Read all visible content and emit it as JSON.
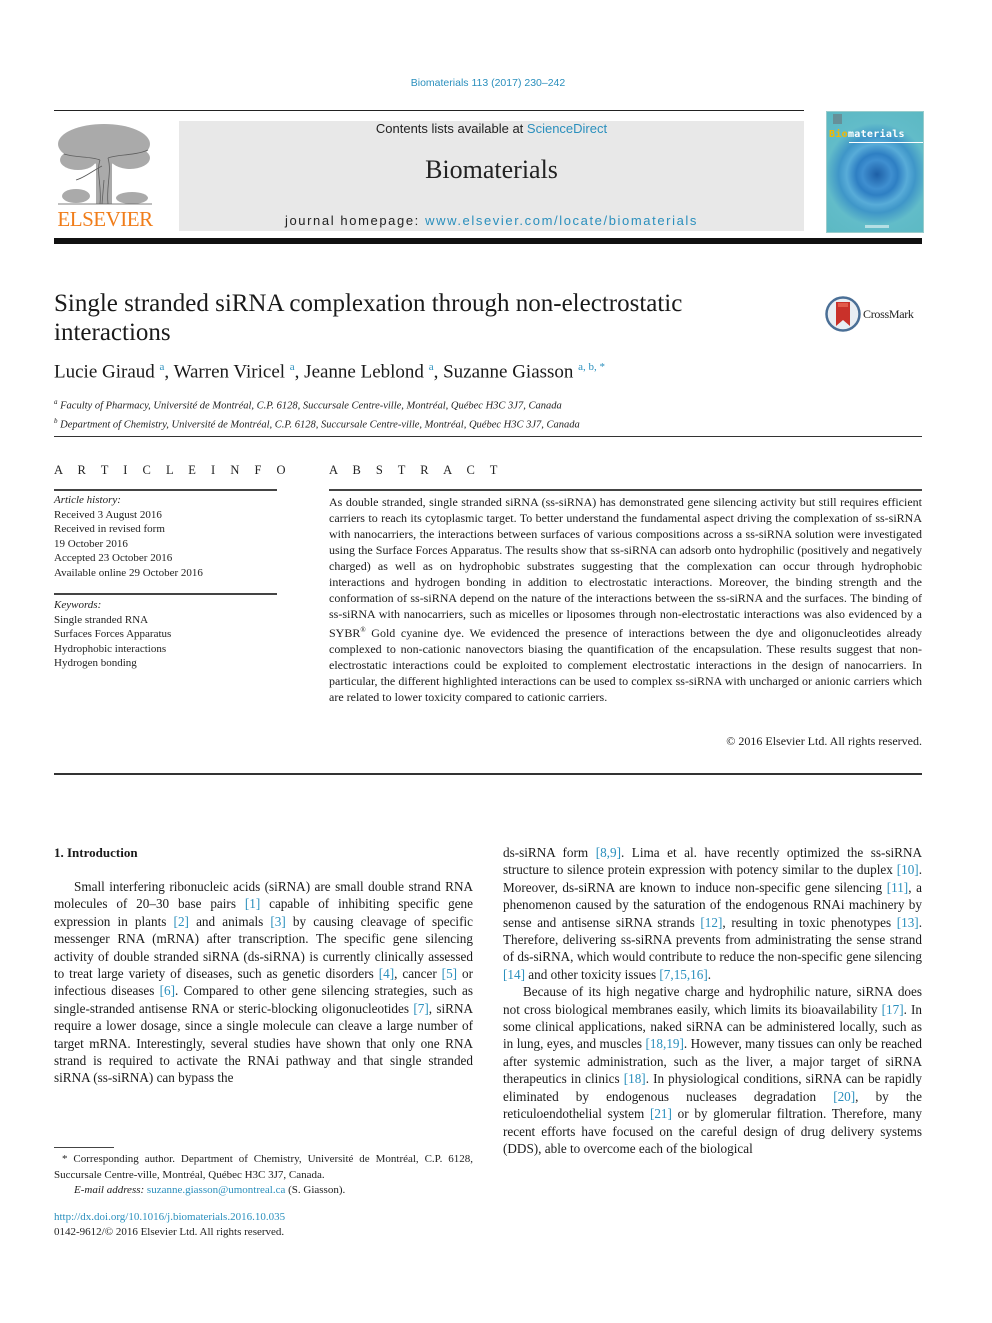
{
  "header": {
    "journal_ref": "Biomaterials 113 (2017) 230–242",
    "contents_prefix": "Contents lists available at ",
    "contents_link": "ScienceDirect",
    "journal_name": "Biomaterials",
    "homepage_prefix": "journal homepage: ",
    "homepage_link": "www.elsevier.com/locate/biomaterials",
    "publisher_wordmark": "ELSEVIER",
    "cover_title_accent": "Bio",
    "cover_title_rest": "materials",
    "publisher_color": "#f07d1a",
    "link_color": "#2a8fbd"
  },
  "article": {
    "title": "Single stranded siRNA complexation through non-electrostatic interactions",
    "crossmark_label": "CrossMark",
    "authors": [
      {
        "name": "Lucie Giraud",
        "sup": "a"
      },
      {
        "name": "Warren Viricel",
        "sup": "a"
      },
      {
        "name": "Jeanne Leblond",
        "sup": "a"
      },
      {
        "name": "Suzanne Giasson",
        "sup": "a, b, *"
      }
    ],
    "affiliations": [
      {
        "mark": "a",
        "text": "Faculty of Pharmacy, Université de Montréal, C.P. 6128, Succursale Centre-ville, Montréal, Québec H3C 3J7, Canada"
      },
      {
        "mark": "b",
        "text": "Department of Chemistry, Université de Montréal, C.P. 6128, Succursale Centre-ville, Montréal, Québec H3C 3J7, Canada"
      }
    ]
  },
  "article_info": {
    "heading": "A R T I C L E   I N F O",
    "history_label": "Article history:",
    "history": [
      "Received 3 August 2016",
      "Received in revised form",
      "19 October 2016",
      "Accepted 23 October 2016",
      "Available online 29 October 2016"
    ],
    "keywords_label": "Keywords:",
    "keywords": [
      "Single stranded RNA",
      "Surfaces Forces Apparatus",
      "Hydrophobic interactions",
      "Hydrogen bonding"
    ]
  },
  "abstract": {
    "heading": "A B S T R A C T",
    "text_part1": "As double stranded, single stranded siRNA (ss-siRNA) has demonstrated gene silencing activity but still requires efficient carriers to reach its cytoplasmic target. To better understand the fundamental aspect driving the complexation of ss-siRNA with nanocarriers, the interactions between surfaces of various compositions across a ss-siRNA solution were investigated using the Surface Forces Apparatus. The results show that ss-siRNA can adsorb onto hydrophilic (positively and negatively charged) as well as on hydrophobic substrates suggesting that the complexation can occur through hydrophobic interactions and hydrogen bonding in addition to electrostatic interactions. Moreover, the binding strength and the conformation of ss-siRNA depend on the nature of the interactions between the ss-siRNA and the surfaces. The binding of ss-siRNA with nanocarriers, such as micelles or liposomes through non-electrostatic interactions was also evidenced by a SYBR",
    "registered_mark": "®",
    "text_part2": " Gold cyanine dye. We evidenced the presence of interactions between the dye and oligonucleotides already complexed to non-cationic nanovectors biasing the quantification of the encapsulation. These results suggest that non-electrostatic interactions could be exploited to complement electrostatic interactions in the design of nanocarriers. In particular, the different highlighted interactions can be used to complex ss-siRNA with uncharged or anionic carriers which are related to lower toxicity compared to cationic carriers.",
    "copyright": "© 2016 Elsevier Ltd. All rights reserved."
  },
  "body": {
    "intro_heading": "1.  Introduction",
    "left_segments": [
      {
        "t": "Small interfering ribonucleic acids (siRNA) are small double strand RNA molecules of 20–30 base pairs "
      },
      {
        "ref": "[1]"
      },
      {
        "t": " capable of inhibiting specific gene expression in plants "
      },
      {
        "ref": "[2]"
      },
      {
        "t": " and animals "
      },
      {
        "ref": "[3]"
      },
      {
        "t": " by causing cleavage of specific messenger RNA (mRNA) after transcription. The specific gene silencing activity of double stranded siRNA (ds-siRNA) is currently clinically assessed to treat large variety of diseases, such as genetic disorders "
      },
      {
        "ref": "[4]"
      },
      {
        "t": ", cancer "
      },
      {
        "ref": "[5]"
      },
      {
        "t": " or infectious diseases "
      },
      {
        "ref": "[6]"
      },
      {
        "t": ". Compared to other gene silencing strategies, such as single-stranded antisense RNA or steric-blocking oligonucleotides "
      },
      {
        "ref": "[7]"
      },
      {
        "t": ", siRNA require a lower dosage, since a single molecule can cleave a large number of target mRNA. Interestingly, several studies have shown that only one RNA strand is required to activate the RNAi pathway and that single stranded siRNA (ss-siRNA) can bypass the"
      }
    ],
    "right_p1_segments": [
      {
        "t": "ds-siRNA form "
      },
      {
        "ref": "[8,9]"
      },
      {
        "t": ". Lima et al. have recently optimized the ss-siRNA structure to silence protein expression with potency similar to the duplex "
      },
      {
        "ref": "[10]"
      },
      {
        "t": ". Moreover, ds-siRNA are known to induce non-specific gene silencing "
      },
      {
        "ref": "[11]"
      },
      {
        "t": ", a phenomenon caused by the saturation of the endogenous RNAi machinery by sense and antisense siRNA strands "
      },
      {
        "ref": "[12]"
      },
      {
        "t": ", resulting in toxic phenotypes "
      },
      {
        "ref": "[13]"
      },
      {
        "t": ". Therefore, delivering ss-siRNA prevents from administrating the sense strand of ds-siRNA, which would contribute to reduce the non-specific gene silencing "
      },
      {
        "ref": "[14]"
      },
      {
        "t": " and other toxicity issues "
      },
      {
        "ref": "[7,15,16]"
      },
      {
        "t": "."
      }
    ],
    "right_p2_segments": [
      {
        "t": "Because of its high negative charge and hydrophilic nature, siRNA does not cross biological membranes easily, which limits its bioavailability "
      },
      {
        "ref": "[17]"
      },
      {
        "t": ". In some clinical applications, naked siRNA can be administered locally, such as in lung, eyes, and muscles "
      },
      {
        "ref": "[18,19]"
      },
      {
        "t": ". However, many tissues can only be reached after systemic administration, such as the liver, a major target of siRNA therapeutics in clinics "
      },
      {
        "ref": "[18]"
      },
      {
        "t": ". In physiological conditions, siRNA can be rapidly eliminated by endogenous nucleases degradation "
      },
      {
        "ref": "[20]"
      },
      {
        "t": ", by the reticuloendothelial system "
      },
      {
        "ref": "[21]"
      },
      {
        "t": " or by glomerular filtration. Therefore, many recent efforts have focused on the careful design of drug delivery systems (DDS), able to overcome each of the biological"
      }
    ]
  },
  "footnotes": {
    "corresponding": "* Corresponding author. Department of Chemistry, Université de Montréal, C.P. 6128, Succursale Centre-ville, Montréal, Québec H3C 3J7, Canada.",
    "email_label": "E-mail address:",
    "email": "suzanne.giasson@umontreal.ca",
    "email_suffix": " (S. Giasson).",
    "doi": "http://dx.doi.org/10.1016/j.biomaterials.2016.10.035",
    "issn_line": "0142-9612/© 2016 Elsevier Ltd. All rights reserved."
  }
}
